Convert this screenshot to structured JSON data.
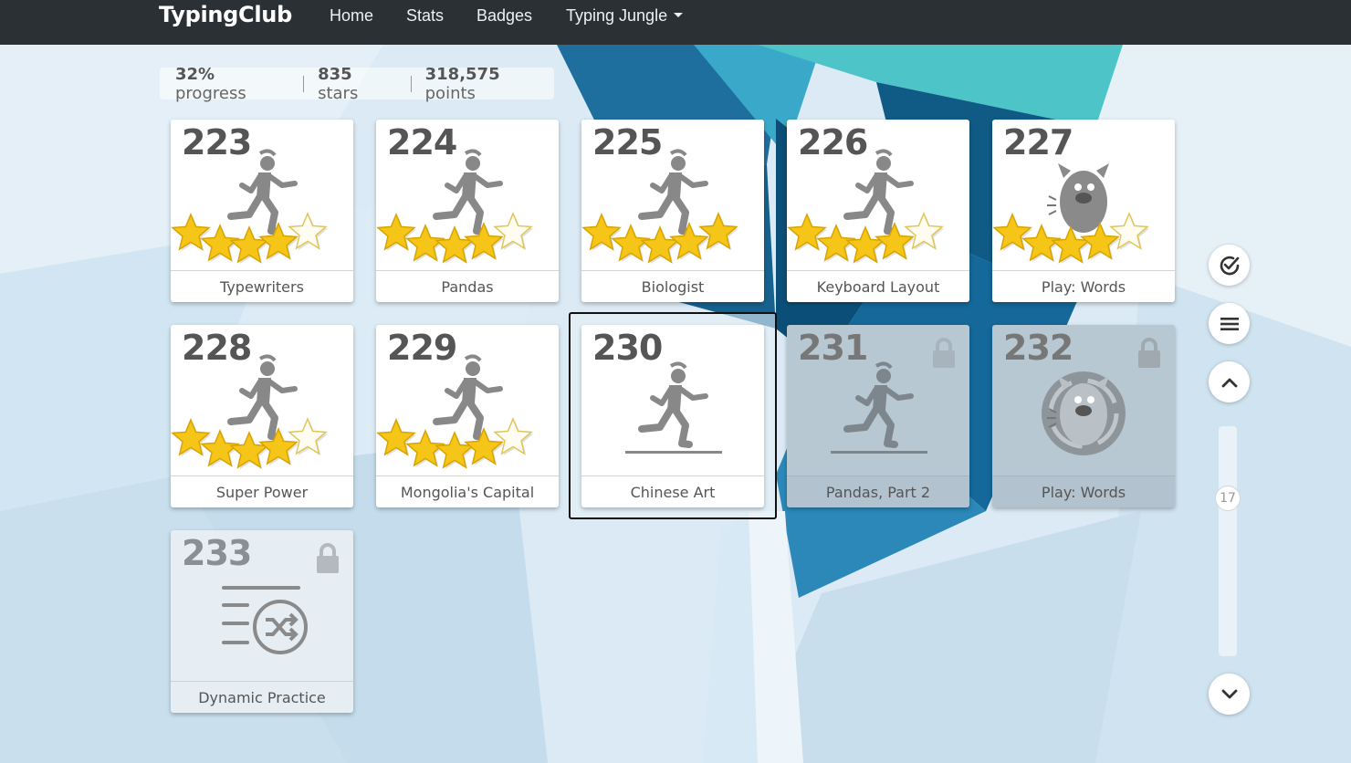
{
  "nav": {
    "brand": "TypingClub",
    "links": [
      "Home",
      "Stats",
      "Badges"
    ],
    "dropdown": "Typing Jungle"
  },
  "stats": {
    "progress_value": "32%",
    "progress_label": "progress",
    "stars_value": "835",
    "stars_label": "stars",
    "points_value": "318,575",
    "points_label": "points"
  },
  "lessons": [
    {
      "num": "223",
      "name": "Typewriters",
      "stars": 4,
      "icon": "runner-icon"
    },
    {
      "num": "224",
      "name": "Pandas",
      "stars": 4,
      "icon": "runner-icon"
    },
    {
      "num": "225",
      "name": "Biologist",
      "stars": 5,
      "icon": "runner-icon"
    },
    {
      "num": "226",
      "name": "Keyboard Layout",
      "stars": 4,
      "icon": "runner-icon"
    },
    {
      "num": "227",
      "name": "Play: Words",
      "stars": 4,
      "icon": "monster-icon"
    },
    {
      "num": "228",
      "name": "Super Power",
      "stars": 4,
      "icon": "runner-icon"
    },
    {
      "num": "229",
      "name": "Mongolia's Capital",
      "stars": 4,
      "icon": "runner-icon"
    },
    {
      "num": "230",
      "name": "Chinese Art",
      "stars": 0,
      "icon": "runner-icon",
      "state": "current"
    },
    {
      "num": "231",
      "name": "Pandas, Part 2",
      "stars": 0,
      "icon": "runner-icon",
      "state": "locked"
    },
    {
      "num": "232",
      "name": "Play: Words",
      "stars": 0,
      "icon": "monster-badge-icon",
      "state": "locked"
    },
    {
      "num": "233",
      "name": "Dynamic Practice",
      "stars": 0,
      "icon": "shuffle-list-icon",
      "state": "locked"
    }
  ],
  "sidebar": {
    "scroll_position": "17",
    "buttons": [
      "check-icon",
      "menu-icon",
      "chevron-up-icon",
      "chevron-down-icon"
    ]
  },
  "colors": {
    "nav_bg": "#2b3034",
    "star_gold": "#f5c518",
    "icon_gray": "#888888"
  }
}
